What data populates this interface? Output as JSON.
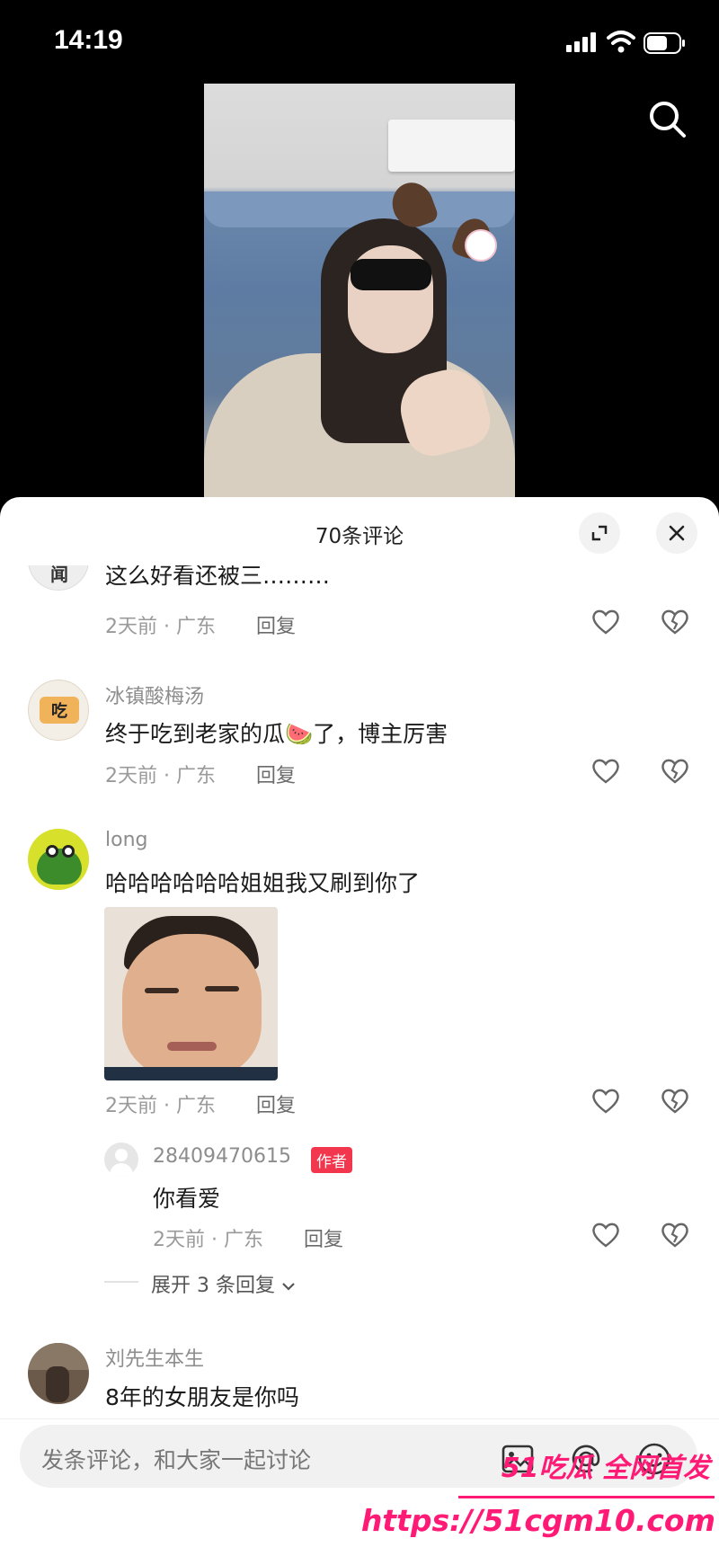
{
  "status_bar": {
    "time": "14:19"
  },
  "panel": {
    "title": "70条评论"
  },
  "comments": [
    {
      "username": "",
      "text": "这么好看还被三………",
      "time": "2天前 · 广东",
      "reply": "回复",
      "avatar_text": "闻"
    },
    {
      "username": "冰镇酸梅汤",
      "text": "终于吃到老家的瓜🍉了，博主厉害",
      "time": "2天前 · 广东",
      "reply": "回复",
      "avatar_text": "吃"
    },
    {
      "username": "long",
      "text": "哈哈哈哈哈哈姐姐我又刷到你了",
      "time": "2天前 · 广东",
      "reply": "回复",
      "sub_reply": {
        "username": "28409470615",
        "tag": "作者",
        "text": "你看爱",
        "time": "2天前 · 广东",
        "reply": "回复"
      },
      "expand_label": "展开 3 条回复"
    },
    {
      "username": "刘先生本生",
      "text": "8年的女朋友是你吗"
    }
  ],
  "input": {
    "placeholder": "发条评论，和大家一起讨论"
  },
  "watermark": {
    "brand": "51吃瓜 全网首发",
    "url": "https://51cgm10.com"
  },
  "icons": [
    "search-icon",
    "expand-icon",
    "close-icon",
    "heart-icon",
    "broken-heart-icon",
    "image-icon",
    "at-icon",
    "emoji-icon",
    "chevron-down-icon"
  ]
}
